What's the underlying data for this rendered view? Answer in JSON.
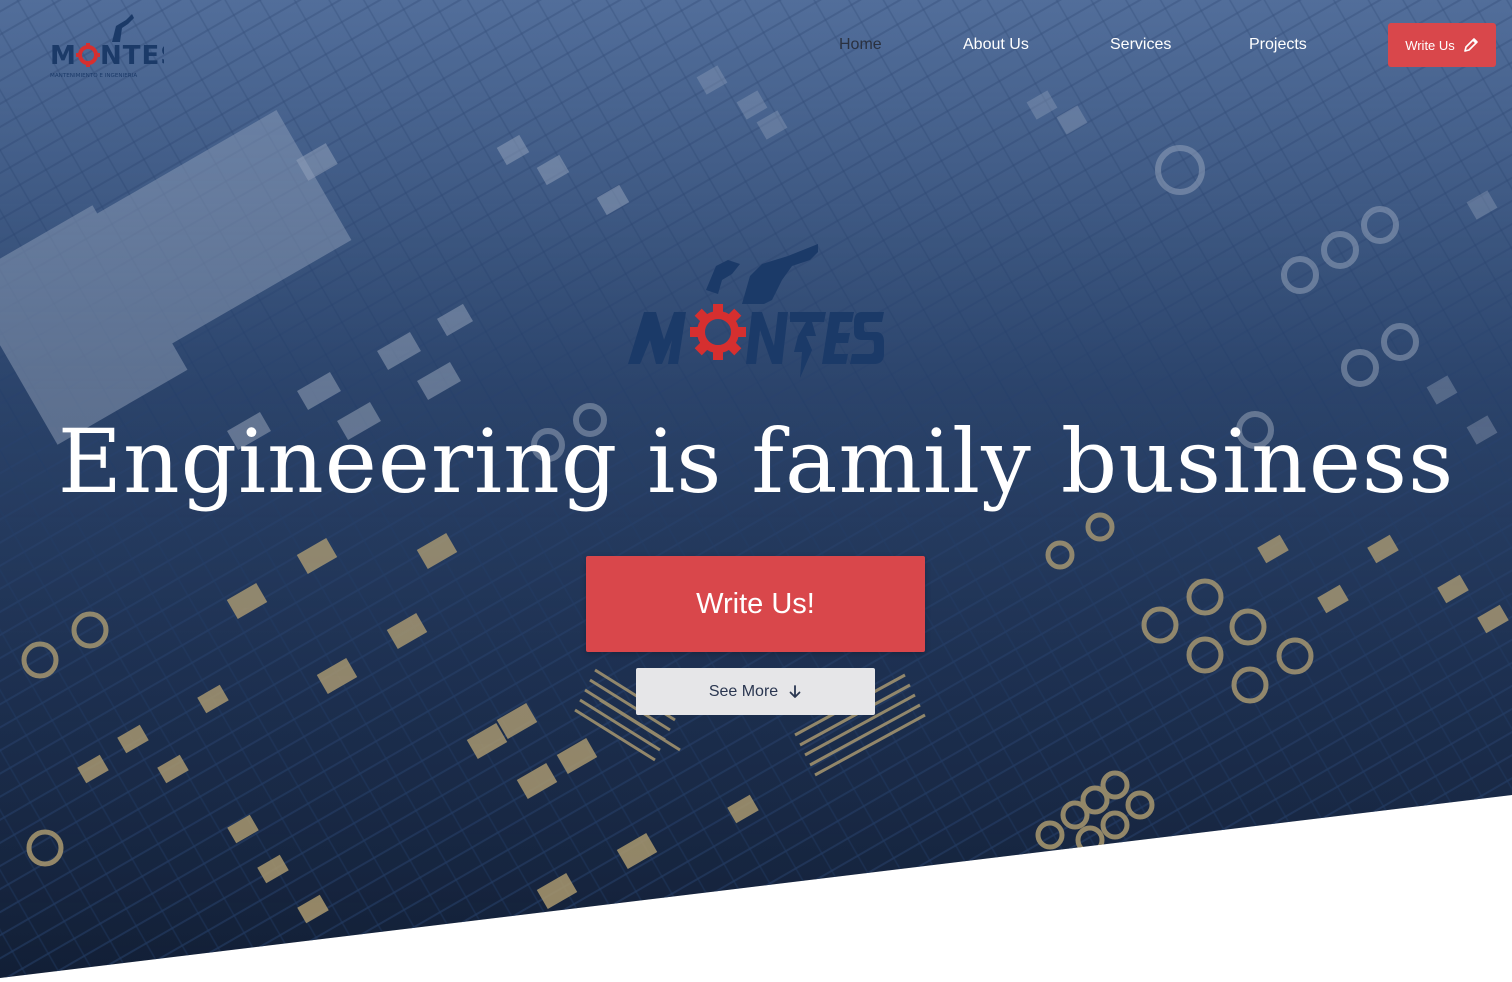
{
  "brand": {
    "name": "MONTES",
    "tagline": "MANTENIMIENTO E INGENIERIA"
  },
  "nav": {
    "items": [
      {
        "label": "Home",
        "active": true
      },
      {
        "label": "About Us",
        "active": false
      },
      {
        "label": "Services",
        "active": false
      },
      {
        "label": "Projects",
        "active": false
      }
    ],
    "cta_label": "Write Us",
    "cta_icon": "pencil-icon"
  },
  "hero": {
    "headline": "Engineering is family business",
    "primary_button": "Write Us!",
    "secondary_button": "See More",
    "secondary_icon": "arrow-down-icon",
    "background": "circuit-board-photo"
  },
  "colors": {
    "accent": "#d9474b",
    "brand_navy": "#1b3a68",
    "gear_red": "#d62f2f",
    "secondary_button_bg": "#e6e6e8",
    "active_nav": "#2a3140"
  }
}
